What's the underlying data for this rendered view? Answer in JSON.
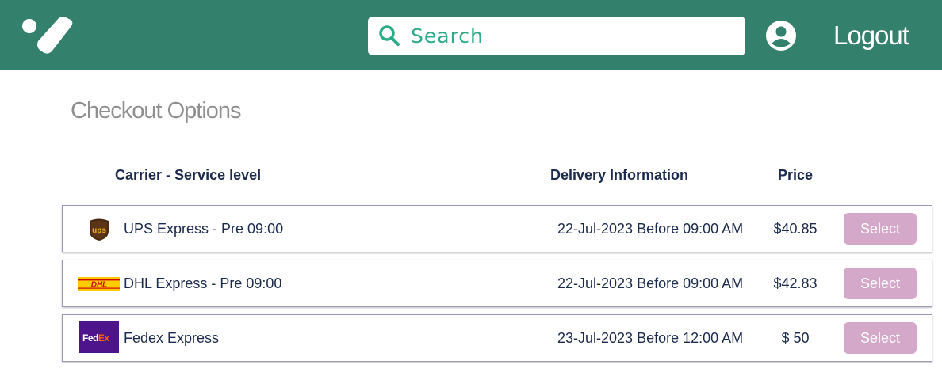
{
  "header": {
    "search_placeholder": "Search",
    "logout_label": "Logout"
  },
  "page": {
    "title": "Checkout Options"
  },
  "columns": {
    "carrier": "Carrier - Service level",
    "delivery": "Delivery Information",
    "price": "Price"
  },
  "options": [
    {
      "service": "UPS Express - Pre 09:00",
      "delivery": "22-Jul-2023 Before 09:00 AM",
      "price": "$40.85",
      "button": "Select",
      "logo_text": "ups"
    },
    {
      "service": "DHL Express - Pre 09:00",
      "delivery": "22-Jul-2023 Before 09:00 AM",
      "price": "$42.83",
      "button": "Select",
      "logo_text": "DHL"
    },
    {
      "service": "Fedex Express",
      "delivery": "23-Jul-2023 Before 12:00 AM",
      "price": "$ 50",
      "button": "Select",
      "logo_text_fed": "Fed",
      "logo_text_ex": "Ex"
    }
  ],
  "colors": {
    "header_bg": "#33806d",
    "accent_text": "#2fab8a",
    "select_button": "#d4a8c8",
    "heading_text": "#1c2a4d"
  },
  "icons": {
    "logo": "brand-logo-icon",
    "search": "search-icon",
    "user": "user-account-icon"
  }
}
